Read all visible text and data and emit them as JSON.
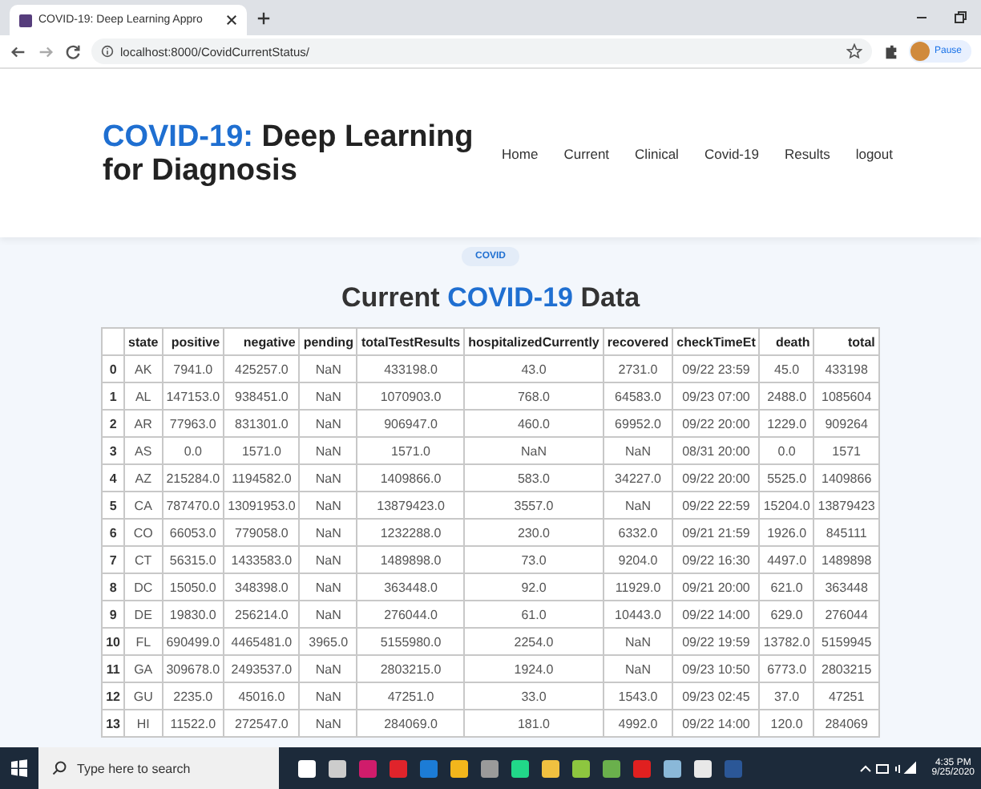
{
  "browser": {
    "tab_title": "COVID-19: Deep Learning Appro",
    "url": "localhost:8000/CovidCurrentStatus/",
    "profile_label": "Pause"
  },
  "site": {
    "title_highlight": "COVID-19:",
    "title_rest": "Deep Learning for Diagnosis",
    "nav": [
      "Home",
      "Current",
      "Clinical",
      "Covid-19",
      "Results",
      "logout"
    ]
  },
  "badge": "COVID",
  "heading": {
    "before": "Current",
    "highlight": "COVID-19",
    "after": "Data"
  },
  "table": {
    "columns": [
      "state",
      "positive",
      "negative",
      "pending",
      "totalTestResults",
      "hospitalizedCurrently",
      "recovered",
      "checkTimeEt",
      "death",
      "total"
    ],
    "rows": [
      {
        "index": "0",
        "cells": [
          "AK",
          "7941.0",
          "425257.0",
          "NaN",
          "433198.0",
          "43.0",
          "2731.0",
          "09/22 23:59",
          "45.0",
          "433198"
        ]
      },
      {
        "index": "1",
        "cells": [
          "AL",
          "147153.0",
          "938451.0",
          "NaN",
          "1070903.0",
          "768.0",
          "64583.0",
          "09/23 07:00",
          "2488.0",
          "1085604"
        ]
      },
      {
        "index": "2",
        "cells": [
          "AR",
          "77963.0",
          "831301.0",
          "NaN",
          "906947.0",
          "460.0",
          "69952.0",
          "09/22 20:00",
          "1229.0",
          "909264"
        ]
      },
      {
        "index": "3",
        "cells": [
          "AS",
          "0.0",
          "1571.0",
          "NaN",
          "1571.0",
          "NaN",
          "NaN",
          "08/31 20:00",
          "0.0",
          "1571"
        ]
      },
      {
        "index": "4",
        "cells": [
          "AZ",
          "215284.0",
          "1194582.0",
          "NaN",
          "1409866.0",
          "583.0",
          "34227.0",
          "09/22 20:00",
          "5525.0",
          "1409866"
        ]
      },
      {
        "index": "5",
        "cells": [
          "CA",
          "787470.0",
          "13091953.0",
          "NaN",
          "13879423.0",
          "3557.0",
          "NaN",
          "09/22 22:59",
          "15204.0",
          "13879423"
        ]
      },
      {
        "index": "6",
        "cells": [
          "CO",
          "66053.0",
          "779058.0",
          "NaN",
          "1232288.0",
          "230.0",
          "6332.0",
          "09/21 21:59",
          "1926.0",
          "845111"
        ]
      },
      {
        "index": "7",
        "cells": [
          "CT",
          "56315.0",
          "1433583.0",
          "NaN",
          "1489898.0",
          "73.0",
          "9204.0",
          "09/22 16:30",
          "4497.0",
          "1489898"
        ]
      },
      {
        "index": "8",
        "cells": [
          "DC",
          "15050.0",
          "348398.0",
          "NaN",
          "363448.0",
          "92.0",
          "11929.0",
          "09/21 20:00",
          "621.0",
          "363448"
        ]
      },
      {
        "index": "9",
        "cells": [
          "DE",
          "19830.0",
          "256214.0",
          "NaN",
          "276044.0",
          "61.0",
          "10443.0",
          "09/22 14:00",
          "629.0",
          "276044"
        ]
      },
      {
        "index": "10",
        "cells": [
          "FL",
          "690499.0",
          "4465481.0",
          "3965.0",
          "5155980.0",
          "2254.0",
          "NaN",
          "09/22 19:59",
          "13782.0",
          "5159945"
        ]
      },
      {
        "index": "11",
        "cells": [
          "GA",
          "309678.0",
          "2493537.0",
          "NaN",
          "2803215.0",
          "1924.0",
          "NaN",
          "09/23 10:50",
          "6773.0",
          "2803215"
        ]
      },
      {
        "index": "12",
        "cells": [
          "GU",
          "2235.0",
          "45016.0",
          "NaN",
          "47251.0",
          "33.0",
          "1543.0",
          "09/23 02:45",
          "37.0",
          "47251"
        ]
      },
      {
        "index": "13",
        "cells": [
          "HI",
          "11522.0",
          "272547.0",
          "NaN",
          "284069.0",
          "181.0",
          "4992.0",
          "09/22 14:00",
          "120.0",
          "284069"
        ]
      }
    ]
  },
  "taskbar": {
    "search_placeholder": "Type here to search",
    "time": "4:35 PM",
    "date": "9/25/2020",
    "apps": [
      {
        "color": "#ffffff"
      },
      {
        "color": "#cccccc"
      },
      {
        "color": "#d01c6b"
      },
      {
        "color": "#e0242b"
      },
      {
        "color": "#1c7cd6"
      },
      {
        "color": "#f2b61c"
      },
      {
        "color": "#9a9a9a"
      },
      {
        "color": "#21d789"
      },
      {
        "color": "#f0c040"
      },
      {
        "color": "#8dc63f"
      },
      {
        "color": "#6ab04c"
      },
      {
        "color": "#e02020"
      },
      {
        "color": "#8ab8d8"
      },
      {
        "color": "#e8e8e8"
      },
      {
        "color": "#2b5797"
      }
    ]
  }
}
